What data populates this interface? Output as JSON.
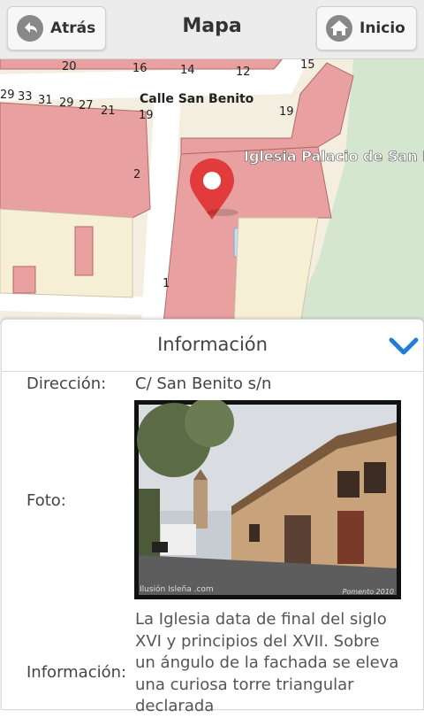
{
  "header": {
    "back_label": "Atrás",
    "title": "Mapa",
    "home_label": "Inicio"
  },
  "map": {
    "street_name": "Calle San Benito",
    "place_label": "Iglesia Palacio de San B",
    "house_numbers": [
      "20",
      "16",
      "14",
      "12",
      "15",
      "29",
      "33",
      "31",
      "29",
      "27",
      "21",
      "19",
      "19",
      "2",
      "1"
    ]
  },
  "info": {
    "title": "Información",
    "address_label": "Dirección:",
    "address_value": "C/ San Benito s/n",
    "photo_label": "Foto:",
    "info_label": "Información:",
    "description": "La Iglesia data de final del siglo XVI y principios del XVII. Sobre un ángulo de la fachada se eleva una curiosa torre triangular declarada",
    "photo_watermark": "Ilusión Isleña .com",
    "photo_year": "Pomento 2010"
  },
  "colors": {
    "header_bg": "#ececec",
    "building_fill": "#e8a0a0",
    "marker": "#e23b3b",
    "accent_chevron": "#1f7fd6",
    "park": "#cfe3cf"
  }
}
